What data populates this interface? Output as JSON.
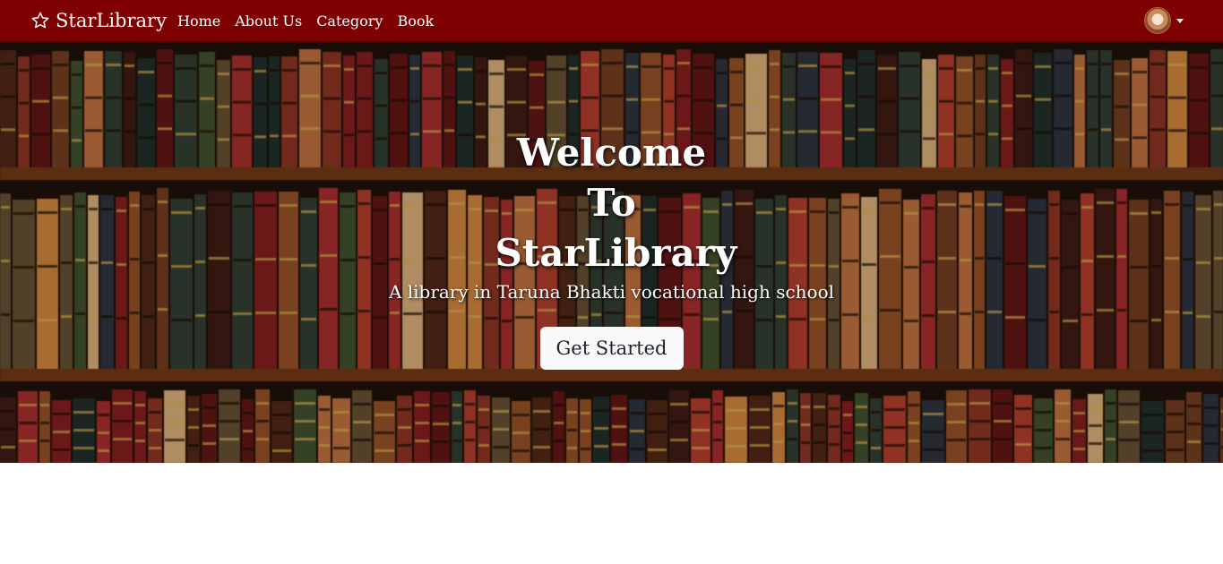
{
  "navbar": {
    "brand": "StarLibrary",
    "brand_icon": "star-outline-icon",
    "links": [
      "Home",
      "About Us",
      "Category",
      "Book"
    ],
    "profile_icon": "user-avatar",
    "dropdown_icon": "caret-down-icon",
    "background_color": "#7f0000"
  },
  "hero": {
    "title_lines": [
      "Welcome",
      "To",
      "StarLibrary"
    ],
    "subtitle": "A library in Taruna Bhakti vocational high school",
    "cta_label": "Get Started",
    "background_image": "bookshelf-photo"
  }
}
